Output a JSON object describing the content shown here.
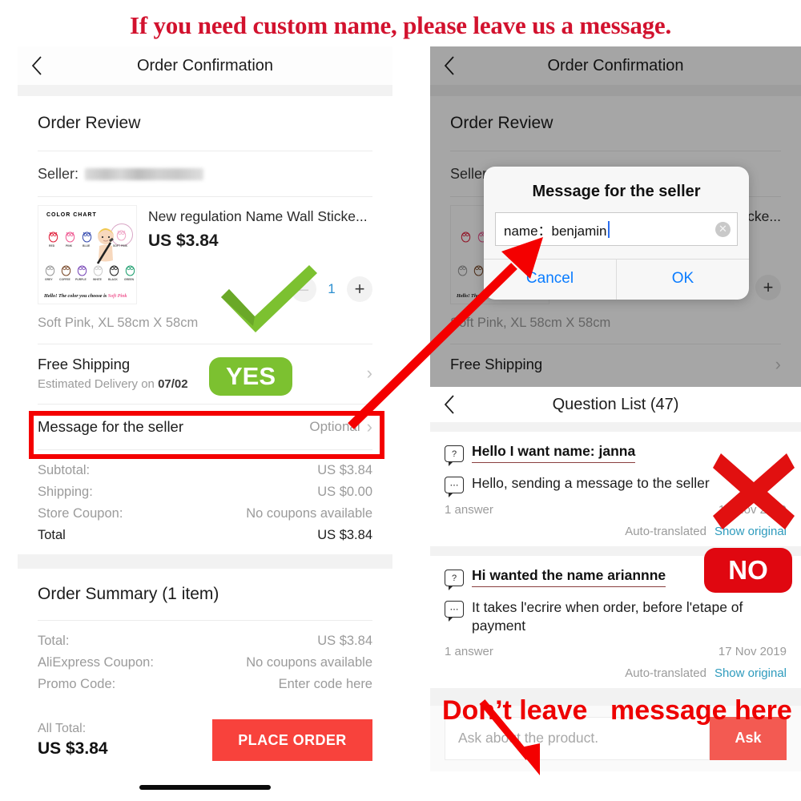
{
  "banner": {
    "text": "If you need custom name, please leave us a message."
  },
  "left_panel": {
    "nav": {
      "title": "Order Confirmation",
      "back_icon": "back-chevron-icon"
    },
    "order_review_title": "Order Review",
    "seller_label": "Seller:",
    "seller_value_redacted": "",
    "product": {
      "title": "New regulation Name Wall Sticke...",
      "price": "US $3.84",
      "quantity": "1",
      "minus_label": "–",
      "plus_label": "+",
      "variant": "Soft Pink, XL 58cm X 58cm",
      "thumb_caption_top": "COLOR CHART",
      "thumb_caption_bottom_prefix": "Hello! The color you choose is ",
      "thumb_caption_bottom_highlight": "Soft Pink",
      "swatch_row1": [
        "RED",
        "PINK",
        "BLUE",
        "SOFT PINK"
      ],
      "swatch_row2": [
        "GREY",
        "COFFEE",
        "PURPLE",
        "WHITE",
        "BLACK",
        "GREEN"
      ]
    },
    "shipping": {
      "title": "Free Shipping",
      "sub_prefix": "Estimated Delivery on ",
      "sub_date": "07/02",
      "chevron": "chevron-right-icon"
    },
    "message_row": {
      "label": "Message for the seller",
      "value": "Optional",
      "chevron": "chevron-right-icon"
    },
    "costs": [
      {
        "label": "Subtotal:",
        "value": "US $3.84",
        "style": "muted"
      },
      {
        "label": "Shipping:",
        "value": "US $0.00",
        "style": "muted"
      },
      {
        "label": "Store Coupon:",
        "value": "No coupons available",
        "style": "teal"
      },
      {
        "label": "Total",
        "value": "US $3.84",
        "style": "total"
      }
    ],
    "order_summary": {
      "title": "Order Summary (1 item)",
      "lines": [
        {
          "label": "Total:",
          "value": "US $3.84",
          "style": "muted"
        },
        {
          "label": "AliExpress Coupon:",
          "value": "No coupons available",
          "style": "teal"
        },
        {
          "label": "Promo Code:",
          "value": "Enter code here",
          "style": "teal"
        }
      ]
    },
    "footer": {
      "all_total_label": "All Total:",
      "all_total_value": "US $3.84",
      "place_order_label": "PLACE ORDER"
    }
  },
  "right_top_panel": {
    "nav": {
      "title": "Order Confirmation",
      "back_icon": "back-chevron-icon"
    },
    "order_review_title": "Order Review",
    "seller_label": "Seller",
    "product_title_fragment": "cke...",
    "variant": "Soft Pink, XL 58cm X 58cm",
    "shipping_title": "Free Shipping",
    "dialog": {
      "title": "Message for the seller",
      "input_value": "name：benjamin",
      "clear_icon": "clear-circle-icon",
      "cancel_label": "Cancel",
      "ok_label": "OK"
    }
  },
  "right_bottom_panel": {
    "nav": {
      "title": "Question List (47)",
      "back_icon": "back-chevron-icon"
    },
    "questions": [
      {
        "question_icon": "question-bubble-icon",
        "question": "Hello I want name: janna",
        "answer_icon": "answer-bubble-icon",
        "answer": "Hello, sending a message to the seller",
        "answer_count": "1 answer",
        "date": "17 Nov 2019",
        "auto_translated": "Auto-translated",
        "show_original": "Show original"
      },
      {
        "question_icon": "question-bubble-icon",
        "question": "Hi wanted the name ariannne",
        "answer_icon": "answer-bubble-icon",
        "answer": "It takes l'ecrire when order, before l'etape of payment",
        "answer_count": "1 answer",
        "date": "17 Nov 2019",
        "auto_translated": "Auto-translated",
        "show_original": "Show original"
      }
    ],
    "ask": {
      "placeholder": "Ask about the product.",
      "button_label": "Ask"
    }
  },
  "annotations": {
    "yes_badge": "YES",
    "no_badge": "NO",
    "check_icon": "green-check-icon",
    "cross_icon": "red-cross-icon",
    "highlight_box": "red-highlight-box",
    "arrow_to_dialog": "red-arrow-icon",
    "arrow_to_ask": "red-arrow-icon",
    "note_left": "Don’t leave",
    "note_right": "message here"
  },
  "colors": {
    "banner_red": "#d2122e",
    "annotation_red": "#f40000",
    "yes_green": "#7cc130",
    "no_red": "#e00710",
    "place_order_red": "#f8423c",
    "ask_red": "#f35a52",
    "link_teal": "#2e9bbd",
    "dialog_blue": "#0a7cff"
  }
}
